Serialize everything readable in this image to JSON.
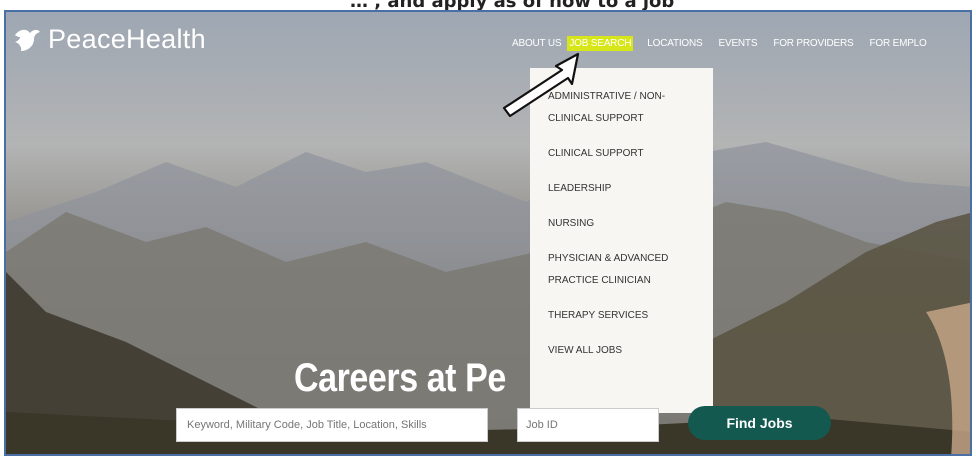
{
  "caption": {
    "text": "… , and apply as of now to a job"
  },
  "brand": {
    "name": "PeaceHealth",
    "logo_icon": "dove-hand-logo-icon"
  },
  "nav": {
    "items": [
      {
        "label": "ABOUT US"
      },
      {
        "label": "JOB SEARCH",
        "active": true
      },
      {
        "label": "LOCATIONS"
      },
      {
        "label": "EVENTS"
      },
      {
        "label": "FOR PROVIDERS"
      },
      {
        "label": "FOR EMPLO"
      }
    ],
    "active_color": "#d7e619"
  },
  "dropdown": {
    "items": [
      "ADMINISTRATIVE / NON-CLINICAL SUPPORT",
      "CLINICAL SUPPORT",
      "LEADERSHIP",
      "NURSING",
      "PHYSICIAN & ADVANCED PRACTICE CLINICIAN",
      "THERAPY SERVICES",
      "VIEW ALL JOBS"
    ]
  },
  "hero": {
    "title": "Careers at Pe"
  },
  "search": {
    "keyword_placeholder": "Keyword, Military Code, Job Title, Location, Skills",
    "jobid_placeholder": "Job ID",
    "button_label": "Find Jobs",
    "button_color": "#14594f"
  },
  "pointer_icon": "arrow-pointer-icon"
}
